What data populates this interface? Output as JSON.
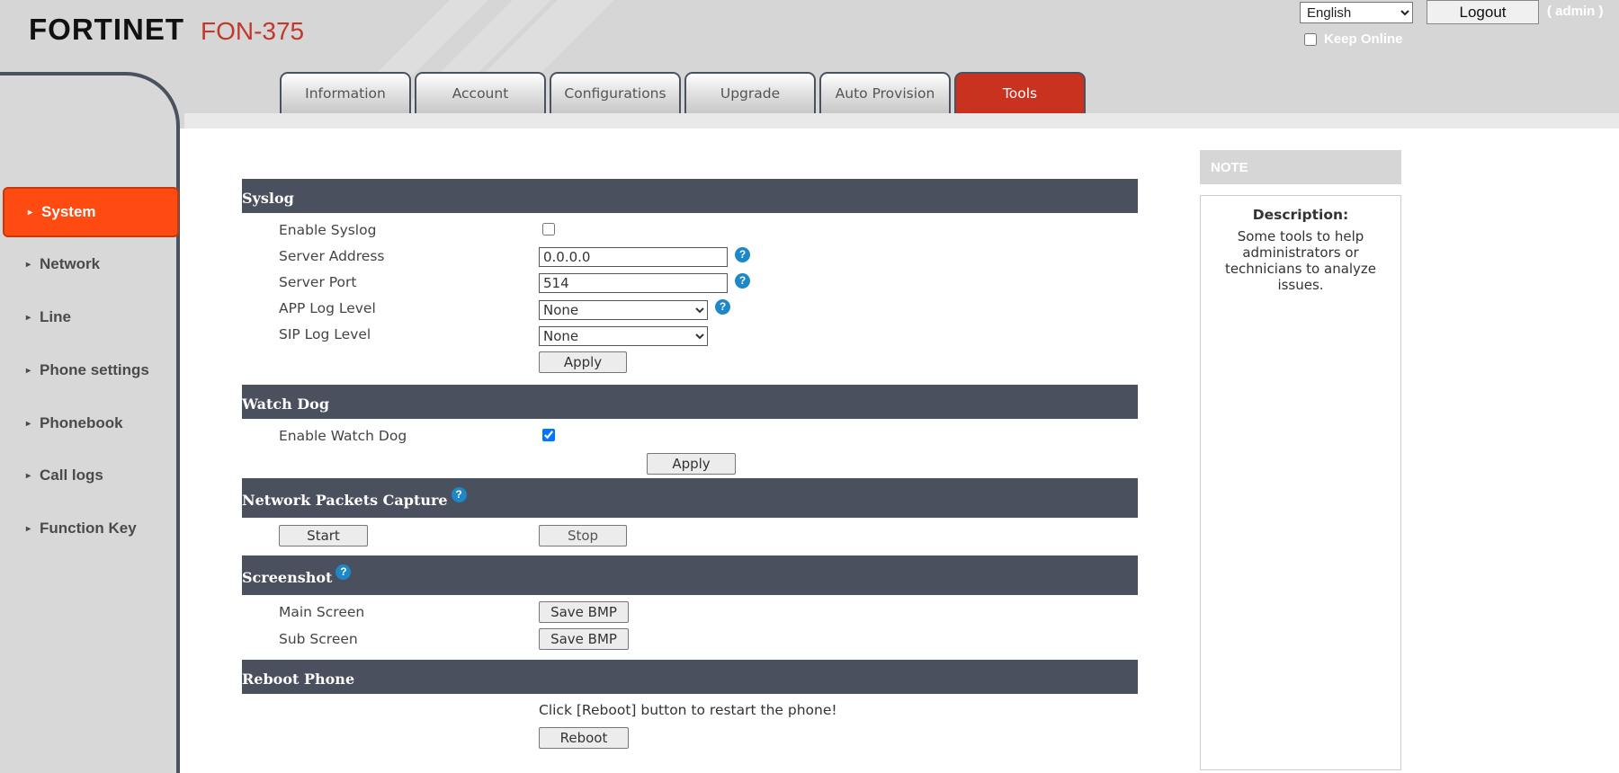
{
  "header": {
    "brand": "FORTINET",
    "model": "FON-375",
    "language": {
      "selected": "English"
    },
    "logout_label": "Logout",
    "user_label": "( admin )",
    "keep_online_label": "Keep Online",
    "keep_online_checked": false
  },
  "tabs": [
    {
      "label": "Information",
      "active": false
    },
    {
      "label": "Account",
      "active": false
    },
    {
      "label": "Configurations",
      "active": false
    },
    {
      "label": "Upgrade",
      "active": false
    },
    {
      "label": "Auto Provision",
      "active": false
    },
    {
      "label": "Tools",
      "active": true
    }
  ],
  "sidebar": {
    "items": [
      {
        "label": "System",
        "active": true
      },
      {
        "label": "Network",
        "active": false
      },
      {
        "label": "Line",
        "active": false
      },
      {
        "label": "Phone settings",
        "active": false
      },
      {
        "label": "Phonebook",
        "active": false
      },
      {
        "label": "Call logs",
        "active": false
      },
      {
        "label": "Function Key",
        "active": false
      }
    ]
  },
  "syslog": {
    "title": "Syslog",
    "enable_label": "Enable Syslog",
    "enable_checked": false,
    "server_address_label": "Server Address",
    "server_address_value": "0.0.0.0",
    "server_port_label": "Server Port",
    "server_port_value": "514",
    "app_log_label": "APP Log Level",
    "app_log_value": "None",
    "sip_log_label": "SIP Log Level",
    "sip_log_value": "None",
    "apply_label": "Apply"
  },
  "watchdog": {
    "title": "Watch Dog",
    "enable_label": "Enable Watch Dog",
    "enable_checked": true,
    "apply_label": "Apply"
  },
  "capture": {
    "title": "Network Packets Capture",
    "start_label": "Start",
    "stop_label": "Stop"
  },
  "screenshot": {
    "title": "Screenshot",
    "main_label": "Main Screen",
    "sub_label": "Sub Screen",
    "save_label": "Save BMP"
  },
  "reboot": {
    "title": "Reboot Phone",
    "hint": "Click [Reboot] button to restart the phone!",
    "button_label": "Reboot"
  },
  "note": {
    "title": "NOTE",
    "desc_title": "Description:",
    "desc_text": "Some tools to help administrators or technicians to analyze issues."
  },
  "colors": {
    "accent": "#ff4a12",
    "active_tab": "#c8321f",
    "section_bar": "#4b505e",
    "help_icon": "#1e87c8"
  },
  "icons": {
    "help": "question-circle-icon",
    "arrow": "caret-right-icon"
  }
}
